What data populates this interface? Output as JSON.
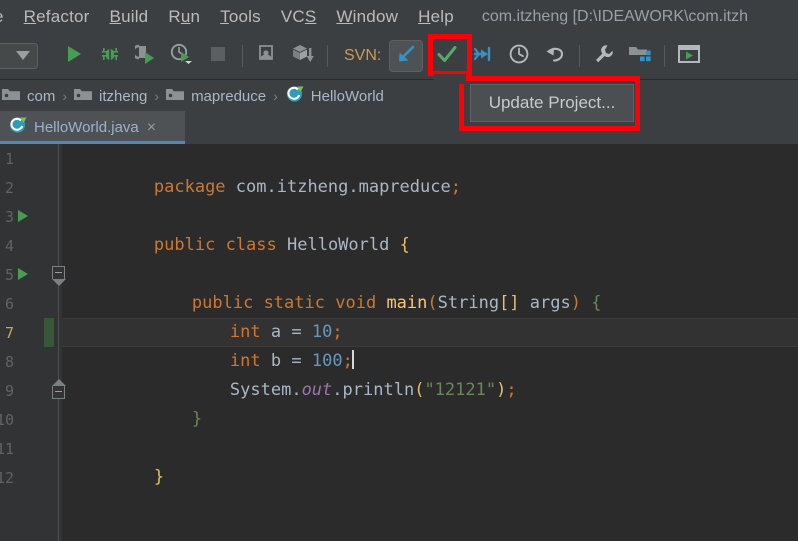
{
  "window": {
    "project_title": "com.itzheng [D:\\IDEAWORK\\com.itzh"
  },
  "menubar": {
    "items": [
      {
        "label": "e",
        "mnemonic": ""
      },
      {
        "label": "Refactor",
        "mnemonic": "R"
      },
      {
        "label": "Build",
        "mnemonic": "B"
      },
      {
        "label": "Run",
        "mnemonic": "u"
      },
      {
        "label": "Tools",
        "mnemonic": "T"
      },
      {
        "label": "VCS",
        "mnemonic": "S"
      },
      {
        "label": "Window",
        "mnemonic": "W"
      },
      {
        "label": "Help",
        "mnemonic": "H"
      }
    ]
  },
  "toolbar": {
    "run_config_dropdown": "chevron-down-icon",
    "svn_label": "SVN:",
    "buttons": [
      {
        "name": "run-button",
        "icon": "play-icon"
      },
      {
        "name": "debug-button",
        "icon": "bug-icon"
      },
      {
        "name": "run-with-coverage-button",
        "icon": "coverage-icon"
      },
      {
        "name": "profile-button",
        "icon": "profiler-icon"
      },
      {
        "name": "stop-button",
        "icon": "stop-square-icon"
      },
      {
        "name": "update-app-button",
        "icon": "update-app-icon"
      },
      {
        "name": "build-artifact-button",
        "icon": "box-down-icon"
      },
      {
        "name": "svn-update-project-button",
        "icon": "arrow-down-left-icon"
      },
      {
        "name": "svn-commit-button",
        "icon": "checkmark-icon"
      },
      {
        "name": "svn-compare-button",
        "icon": "arrow-to-line-icon"
      },
      {
        "name": "svn-history-button",
        "icon": "clock-icon"
      },
      {
        "name": "svn-rollback-button",
        "icon": "undo-arrow-icon"
      },
      {
        "name": "settings-button",
        "icon": "wrench-icon"
      },
      {
        "name": "project-structure-button",
        "icon": "folder-blocks-icon"
      },
      {
        "name": "run-window-button",
        "icon": "window-play-icon"
      }
    ]
  },
  "breadcrumb": {
    "separator": "›",
    "items": [
      {
        "label": "com",
        "icon": "folder-icon"
      },
      {
        "label": "itzheng",
        "icon": "folder-icon"
      },
      {
        "label": "mapreduce",
        "icon": "folder-icon"
      },
      {
        "label": "HelloWorld",
        "icon": "java-class-icon"
      }
    ]
  },
  "tabs": {
    "active": {
      "label": "HelloWorld.java",
      "icon": "java-class-icon",
      "close": "×"
    }
  },
  "tooltip": {
    "text": "Update Project..."
  },
  "editor": {
    "current_line": 7,
    "lines": [
      {
        "n": "1",
        "num_label": "1"
      },
      {
        "n": "2",
        "num_label": "2"
      },
      {
        "n": "3",
        "num_label": "3"
      },
      {
        "n": "4",
        "num_label": "4"
      },
      {
        "n": "5",
        "num_label": "5"
      },
      {
        "n": "6",
        "num_label": "6"
      },
      {
        "n": "7",
        "num_label": "7"
      },
      {
        "n": "8",
        "num_label": "8"
      },
      {
        "n": "9",
        "num_label": "9"
      },
      {
        "n": "10",
        "num_label": "10"
      },
      {
        "n": "11",
        "num_label": "11"
      },
      {
        "n": "12",
        "num_label": "12"
      }
    ],
    "code_text": {
      "l1": "package com.itzheng.mapreduce;",
      "l3": "public class HelloWorld {",
      "l5": "public static void main(String[] args) {",
      "l6": "int a = 10;",
      "l7": "int b = 100;",
      "l8": "System.out.println(\"12121\");",
      "l9": "}",
      "l11": "}",
      "t_package": "package",
      "t_pkgname": "com.itzheng.mapreduce",
      "t_semi": ";",
      "t_public": "public",
      "t_class": "class",
      "t_clsname": "HelloWorld",
      "t_obrace": "{",
      "t_static": "static",
      "t_void": "void",
      "t_main": "main",
      "t_oparen": "(",
      "t_String": "String",
      "t_brackets": "[]",
      "t_args": "args",
      "t_cparen": ")",
      "t_int": "int",
      "t_a": "a",
      "t_eq": "=",
      "t_10": "10",
      "t_b": "b",
      "t_100": "100",
      "t_System": "System",
      "t_dot": ".",
      "t_out": "out",
      "t_println": "println",
      "t_str12121": "\"12121\"",
      "t_cbrace": "}"
    }
  },
  "colors": {
    "background": "#3c3f41",
    "editor_background": "#2b2b2b",
    "gutter": "#313335",
    "accent_blue": "#4a88c7",
    "svn_arrow": "#3592c4",
    "commit_green": "#59a869",
    "annotation_red": "#fb0007",
    "keyword_orange": "#cc7832",
    "string_green": "#6a8759",
    "number_blue": "#6897bb",
    "method_yellow": "#ffc66d",
    "field_purple": "#9876aa",
    "text_grey": "#a9b7c6",
    "change_bar_green": "#385639"
  }
}
